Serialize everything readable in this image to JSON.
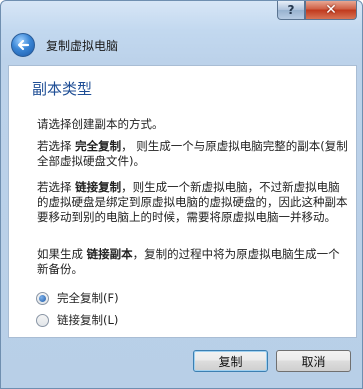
{
  "window": {
    "help_label": "?",
    "close_label": "✕"
  },
  "header": {
    "back_icon": "back-arrow-icon",
    "title": "复制虚拟电脑"
  },
  "page": {
    "heading": "副本类型",
    "intro": "请选择创建副本的方式。",
    "full_pre": "若选择 ",
    "full_term": "完全复制",
    "full_post": "， 则生成一个与原虚拟电脑完整的副本(复制全部虚拟硬盘文件)。",
    "linked_pre": "若选择 ",
    "linked_term": "链接复制",
    "linked_post": "，则生成一个新虚拟电脑，不过新虚拟电脑的虚拟硬盘是绑定到原虚拟电脑的虚拟硬盘的，因此这种副本要移动到别的电脑上的时候，需要将原虚拟电脑一并移动。",
    "snap_pre": "如果生成 ",
    "snap_term": "链接副本",
    "snap_post": "，复制的过程中将为原虚拟电脑生成一个新备份。"
  },
  "options": [
    {
      "label": "完全复制(F)",
      "selected": true
    },
    {
      "label": "链接复制(L)",
      "selected": false
    }
  ],
  "buttons": {
    "copy": "复制",
    "cancel": "取消"
  }
}
